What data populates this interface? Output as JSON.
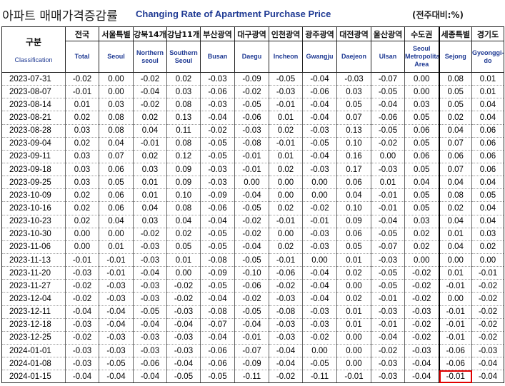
{
  "title": {
    "korean": "아파트 매매가격증감률",
    "english": "Changing Rate of Apartment Purchase Price",
    "unit": "(전주대비:%)"
  },
  "header": {
    "corner_kr": "구분",
    "corner_en": "Classification",
    "columns": [
      {
        "kr": "전국",
        "en": "Total"
      },
      {
        "kr": "서울특별",
        "en": "Seoul"
      },
      {
        "kr": "강북14개",
        "en": "Northern seoul"
      },
      {
        "kr": "강남11개",
        "en": "Southern Seoul"
      },
      {
        "kr": "부산광역",
        "en": "Busan"
      },
      {
        "kr": "대구광역",
        "en": "Daegu"
      },
      {
        "kr": "인천광역",
        "en": "Incheon"
      },
      {
        "kr": "광주광역",
        "en": "Gwangju"
      },
      {
        "kr": "대전광역",
        "en": "Daejeon"
      },
      {
        "kr": "울산광역",
        "en": "Ulsan"
      },
      {
        "kr": "수도권",
        "en": "Seoul Metropolitan Area"
      },
      {
        "kr": "세종특별",
        "en": "Sejong"
      },
      {
        "kr": "경기도",
        "en": "Gyeonggi-do"
      }
    ]
  },
  "rows": [
    {
      "date": "2023-07-31",
      "values": [
        "-0.02",
        "0.00",
        "-0.02",
        "0.02",
        "-0.03",
        "-0.09",
        "-0.05",
        "-0.04",
        "-0.03",
        "-0.07",
        "0.00",
        "0.08",
        "0.01"
      ]
    },
    {
      "date": "2023-08-07",
      "values": [
        "-0.01",
        "0.00",
        "-0.04",
        "0.03",
        "-0.06",
        "-0.02",
        "-0.03",
        "-0.06",
        "0.03",
        "-0.05",
        "0.00",
        "0.05",
        "0.01"
      ]
    },
    {
      "date": "2023-08-14",
      "values": [
        "0.01",
        "0.03",
        "-0.02",
        "0.08",
        "-0.03",
        "-0.05",
        "-0.01",
        "-0.04",
        "0.05",
        "-0.04",
        "0.03",
        "0.05",
        "0.04"
      ]
    },
    {
      "date": "2023-08-21",
      "values": [
        "0.02",
        "0.08",
        "0.02",
        "0.13",
        "-0.04",
        "-0.06",
        "0.01",
        "-0.04",
        "0.07",
        "-0.06",
        "0.05",
        "0.02",
        "0.04"
      ]
    },
    {
      "date": "2023-08-28",
      "values": [
        "0.03",
        "0.08",
        "0.04",
        "0.11",
        "-0.02",
        "-0.03",
        "0.02",
        "-0.03",
        "0.13",
        "-0.05",
        "0.06",
        "0.04",
        "0.06"
      ]
    },
    {
      "date": "2023-09-04",
      "values": [
        "0.02",
        "0.04",
        "-0.01",
        "0.08",
        "-0.05",
        "-0.08",
        "-0.01",
        "-0.05",
        "0.10",
        "-0.02",
        "0.05",
        "0.07",
        "0.06"
      ]
    },
    {
      "date": "2023-09-11",
      "values": [
        "0.03",
        "0.07",
        "0.02",
        "0.12",
        "-0.05",
        "-0.01",
        "0.01",
        "-0.04",
        "0.16",
        "0.00",
        "0.06",
        "0.06",
        "0.06"
      ]
    },
    {
      "date": "2023-09-18",
      "values": [
        "0.03",
        "0.06",
        "0.03",
        "0.09",
        "-0.03",
        "-0.01",
        "0.02",
        "-0.03",
        "0.17",
        "-0.03",
        "0.05",
        "0.07",
        "0.06"
      ]
    },
    {
      "date": "2023-09-25",
      "values": [
        "0.03",
        "0.05",
        "0.01",
        "0.09",
        "-0.03",
        "0.00",
        "0.00",
        "0.00",
        "0.06",
        "0.01",
        "0.04",
        "0.04",
        "0.04"
      ]
    },
    {
      "date": "2023-10-09",
      "values": [
        "0.02",
        "0.06",
        "0.01",
        "0.10",
        "-0.09",
        "-0.04",
        "0.00",
        "0.00",
        "0.04",
        "-0.01",
        "0.05",
        "0.08",
        "0.05"
      ]
    },
    {
      "date": "2023-10-16",
      "values": [
        "0.02",
        "0.06",
        "0.04",
        "0.08",
        "-0.06",
        "-0.05",
        "0.02",
        "-0.02",
        "0.10",
        "-0.01",
        "0.05",
        "0.02",
        "0.04"
      ]
    },
    {
      "date": "2023-10-23",
      "values": [
        "0.02",
        "0.04",
        "0.03",
        "0.04",
        "-0.04",
        "-0.02",
        "-0.01",
        "-0.01",
        "0.09",
        "-0.04",
        "0.03",
        "0.04",
        "0.04"
      ]
    },
    {
      "date": "2023-10-30",
      "values": [
        "0.00",
        "0.00",
        "-0.02",
        "0.02",
        "-0.05",
        "-0.02",
        "0.00",
        "-0.03",
        "0.06",
        "-0.05",
        "0.02",
        "0.01",
        "0.03"
      ]
    },
    {
      "date": "2023-11-06",
      "values": [
        "0.00",
        "0.01",
        "-0.03",
        "0.05",
        "-0.05",
        "-0.04",
        "0.02",
        "-0.03",
        "0.05",
        "-0.07",
        "0.02",
        "0.04",
        "0.02"
      ]
    },
    {
      "date": "2023-11-13",
      "values": [
        "-0.01",
        "-0.01",
        "-0.03",
        "0.01",
        "-0.08",
        "-0.05",
        "-0.01",
        "0.00",
        "0.01",
        "-0.03",
        "0.00",
        "0.00",
        "0.00"
      ]
    },
    {
      "date": "2023-11-20",
      "values": [
        "-0.03",
        "-0.01",
        "-0.04",
        "0.00",
        "-0.09",
        "-0.10",
        "-0.06",
        "-0.04",
        "0.02",
        "-0.05",
        "-0.02",
        "0.01",
        "-0.01"
      ]
    },
    {
      "date": "2023-11-27",
      "values": [
        "-0.02",
        "-0.03",
        "-0.03",
        "-0.02",
        "-0.05",
        "-0.06",
        "-0.02",
        "-0.04",
        "0.00",
        "-0.05",
        "-0.02",
        "-0.01",
        "-0.02"
      ]
    },
    {
      "date": "2023-12-04",
      "values": [
        "-0.02",
        "-0.03",
        "-0.03",
        "-0.02",
        "-0.04",
        "-0.02",
        "-0.03",
        "-0.04",
        "0.02",
        "-0.01",
        "-0.02",
        "0.00",
        "-0.02"
      ]
    },
    {
      "date": "2023-12-11",
      "values": [
        "-0.04",
        "-0.04",
        "-0.05",
        "-0.03",
        "-0.08",
        "-0.05",
        "-0.08",
        "-0.03",
        "0.01",
        "-0.03",
        "-0.03",
        "-0.01",
        "-0.02"
      ]
    },
    {
      "date": "2023-12-18",
      "values": [
        "-0.03",
        "-0.04",
        "-0.04",
        "-0.04",
        "-0.07",
        "-0.04",
        "-0.03",
        "-0.03",
        "0.01",
        "-0.01",
        "-0.02",
        "-0.01",
        "-0.02"
      ]
    },
    {
      "date": "2023-12-25",
      "values": [
        "-0.02",
        "-0.03",
        "-0.03",
        "-0.03",
        "-0.04",
        "-0.01",
        "-0.03",
        "-0.02",
        "0.00",
        "-0.04",
        "-0.02",
        "-0.01",
        "-0.02"
      ]
    },
    {
      "date": "2024-01-01",
      "values": [
        "-0.03",
        "-0.03",
        "-0.03",
        "-0.03",
        "-0.06",
        "-0.07",
        "-0.04",
        "0.00",
        "0.00",
        "-0.02",
        "-0.03",
        "-0.06",
        "-0.03"
      ]
    },
    {
      "date": "2024-01-08",
      "values": [
        "-0.03",
        "-0.05",
        "-0.06",
        "-0.04",
        "-0.06",
        "-0.09",
        "-0.04",
        "-0.05",
        "0.00",
        "-0.03",
        "-0.04",
        "-0.06",
        "-0.04"
      ]
    },
    {
      "date": "2024-01-15",
      "values": [
        "-0.04",
        "-0.04",
        "-0.04",
        "-0.05",
        "-0.05",
        "-0.11",
        "-0.02",
        "-0.11",
        "-0.01",
        "-0.03",
        "-0.04",
        "-0.01",
        "-0.04"
      ]
    }
  ],
  "highlight": {
    "row": 23,
    "col": 11,
    "color": "#e00000"
  }
}
